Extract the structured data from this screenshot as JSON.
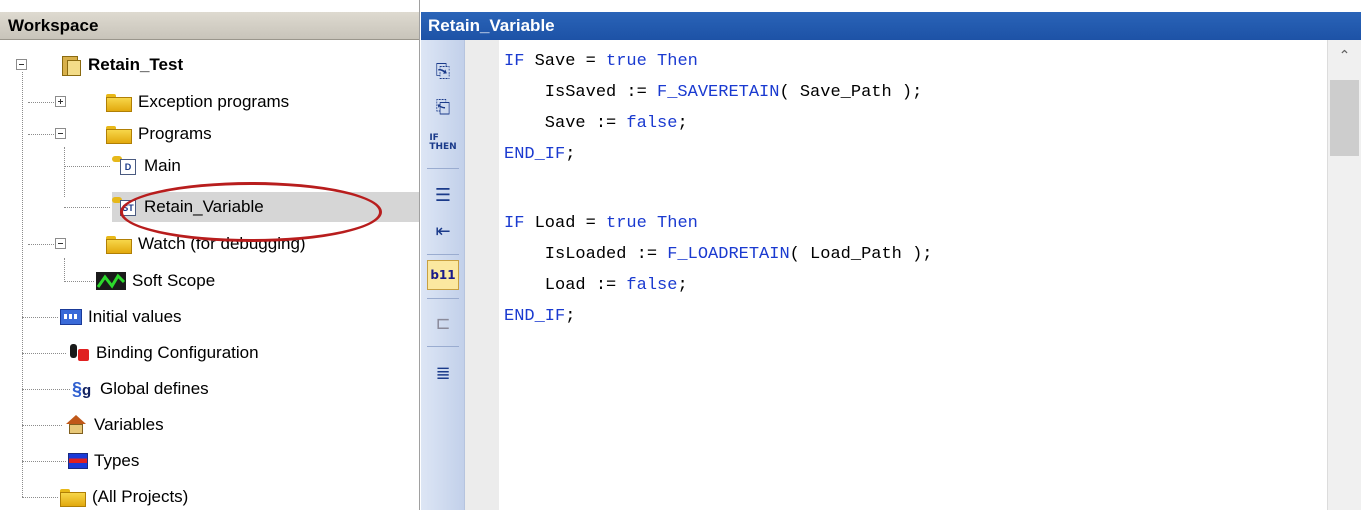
{
  "workspace": {
    "title": "Workspace",
    "tree": [
      {
        "label": "Retain_Test",
        "icon": "project-icon"
      },
      {
        "label": "Exception programs",
        "icon": "folder-icon"
      },
      {
        "label": "Programs",
        "icon": "folder-icon"
      },
      {
        "label": "Main",
        "icon": "pou-icon",
        "icon_text": "D"
      },
      {
        "label": "Retain_Variable",
        "icon": "pou-icon",
        "icon_text": "ST"
      },
      {
        "label": "Watch (for debugging)",
        "icon": "folder-icon"
      },
      {
        "label": "Soft Scope",
        "icon": "scope-icon"
      },
      {
        "label": "Initial values",
        "icon": "grid-icon"
      },
      {
        "label": "Binding Configuration",
        "icon": "binding-icon"
      },
      {
        "label": "Global defines",
        "icon": "defines-icon"
      },
      {
        "label": "Variables",
        "icon": "house-icon"
      },
      {
        "label": "Types",
        "icon": "types-icon"
      },
      {
        "label": "(All Projects)",
        "icon": "folder-icon"
      }
    ]
  },
  "editor": {
    "tab_title": "Retain_Variable",
    "toolbar": [
      {
        "name": "insert-before-icon"
      },
      {
        "name": "insert-after-icon"
      },
      {
        "name": "if-then-icon",
        "text_top": "IF",
        "text_bottom": "THEN"
      },
      {
        "name": "indent-icon"
      },
      {
        "name": "outdent-icon"
      },
      {
        "name": "line-numbers-icon",
        "text": "b11"
      },
      {
        "name": "blocks-icon"
      },
      {
        "name": "format-icon"
      }
    ],
    "code_lines": [
      {
        "pre": "",
        "kw1": "IF",
        "mid": " Save = ",
        "kw2": "true",
        "mid2": " ",
        "kw3": "Then",
        "post": ""
      },
      {
        "pre": "    IsSaved := ",
        "kw1": "F_SAVERETAIN",
        "mid": "( Save_Path );",
        "kw2": "",
        "mid2": "",
        "kw3": "",
        "post": ""
      },
      {
        "pre": "    Save := ",
        "kw1": "false",
        "mid": ";",
        "kw2": "",
        "mid2": "",
        "kw3": "",
        "post": ""
      },
      {
        "pre": "",
        "kw1": "END_IF",
        "mid": ";",
        "kw2": "",
        "mid2": "",
        "kw3": "",
        "post": ""
      },
      {
        "pre": "",
        "kw1": "",
        "mid": "",
        "kw2": "",
        "mid2": "",
        "kw3": "",
        "post": ""
      },
      {
        "pre": "",
        "kw1": "IF",
        "mid": " Load = ",
        "kw2": "true",
        "mid2": " ",
        "kw3": "Then",
        "post": ""
      },
      {
        "pre": "    IsLoaded := ",
        "kw1": "F_LOADRETAIN",
        "mid": "( Load_Path );",
        "kw2": "",
        "mid2": "",
        "kw3": "",
        "post": ""
      },
      {
        "pre": "    Load := ",
        "kw1": "false",
        "mid": ";",
        "kw2": "",
        "mid2": "",
        "kw3": "",
        "post": ""
      },
      {
        "pre": "",
        "kw1": "END_IF",
        "mid": ";",
        "kw2": "",
        "mid2": "",
        "kw3": "",
        "post": ""
      }
    ]
  },
  "colors": {
    "keyword": "#1a3ad0",
    "tab_bg": "#1d52a6",
    "annotation": "#b81d1d",
    "selection": "#d6d6d6"
  }
}
